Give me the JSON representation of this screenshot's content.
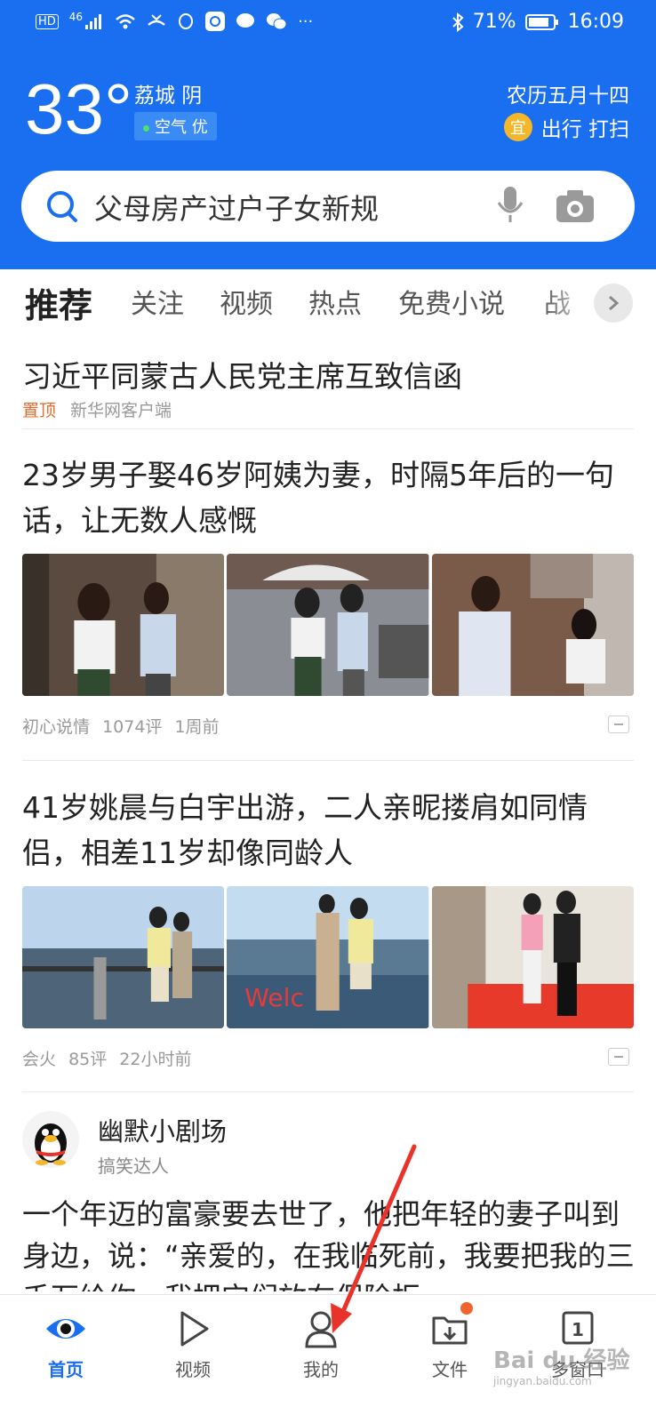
{
  "status": {
    "battery": "71%",
    "time": "16:09",
    "network": "46"
  },
  "weather": {
    "temp": "33°",
    "city": "荔城 阴",
    "air": "空气 优",
    "lunar": "农历五月十四",
    "yi_badge": "宜",
    "yi_text": "出行 打扫"
  },
  "search": {
    "placeholder": "父母房产过户子女新规"
  },
  "tabs": [
    {
      "label": "推荐"
    },
    {
      "label": "关注"
    },
    {
      "label": "视频"
    },
    {
      "label": "热点"
    },
    {
      "label": "免费小说"
    },
    {
      "label": "战"
    }
  ],
  "feed": {
    "pinned": {
      "title": "习近平同蒙古人民党主席互致信函",
      "tag": "置顶",
      "source": "新华网客户端"
    },
    "item1": {
      "title": "23岁男子娶46岁阿姨为妻，时隔5年后的一句话，让无数人感慨",
      "source": "初心说情",
      "comments": "1074评",
      "time": "1周前"
    },
    "item2": {
      "title": "41岁姚晨与白宇出游，二人亲昵搂肩如同情侣，相差11岁却像同龄人",
      "source": "会火",
      "comments": "85评",
      "time": "22小时前"
    },
    "item3": {
      "author": "幽默小剧场",
      "author_sub": "搞笑达人",
      "text": "一个年迈的富豪要去世了，他把年轻的妻子叫到身边，说：“亲爱的，在我临死前，我要把我的三千万给你，我把它们放在保险柜"
    }
  },
  "nav": [
    {
      "label": "首页",
      "icon": "eye-icon"
    },
    {
      "label": "视频",
      "icon": "play-icon"
    },
    {
      "label": "我的",
      "icon": "person-icon"
    },
    {
      "label": "文件",
      "icon": "folder-download-icon"
    },
    {
      "label": "多窗口",
      "icon": "window-count-icon",
      "count": "1"
    }
  ],
  "watermark": {
    "main": "Bai du 经验",
    "sub": "jingyan.baidu.com"
  },
  "colors": {
    "brand": "#1a6ef0",
    "accent": "#f2622c"
  }
}
